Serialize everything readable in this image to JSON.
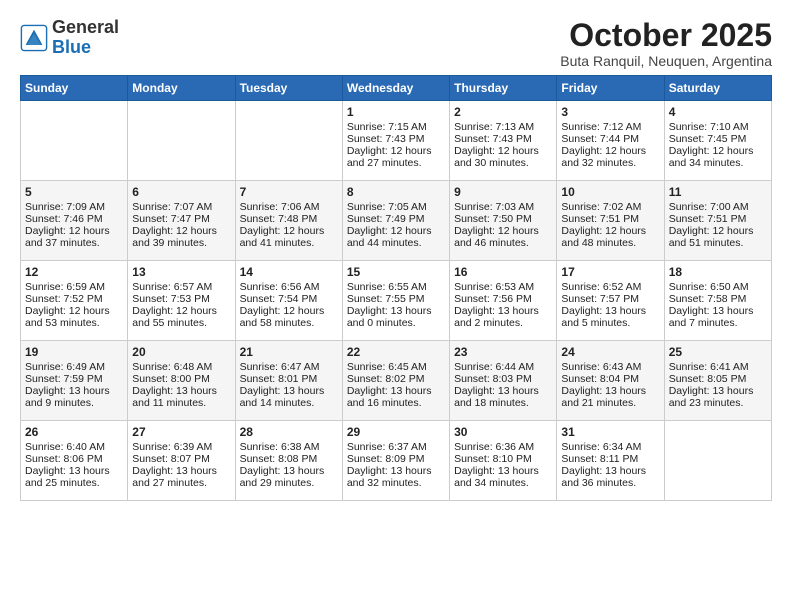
{
  "logo": {
    "general": "General",
    "blue": "Blue"
  },
  "title": "October 2025",
  "subtitle": "Buta Ranquil, Neuquen, Argentina",
  "days_of_week": [
    "Sunday",
    "Monday",
    "Tuesday",
    "Wednesday",
    "Thursday",
    "Friday",
    "Saturday"
  ],
  "weeks": [
    [
      {
        "day": "",
        "info": ""
      },
      {
        "day": "",
        "info": ""
      },
      {
        "day": "",
        "info": ""
      },
      {
        "day": "1",
        "info": "Sunrise: 7:15 AM\nSunset: 7:43 PM\nDaylight: 12 hours\nand 27 minutes."
      },
      {
        "day": "2",
        "info": "Sunrise: 7:13 AM\nSunset: 7:43 PM\nDaylight: 12 hours\nand 30 minutes."
      },
      {
        "day": "3",
        "info": "Sunrise: 7:12 AM\nSunset: 7:44 PM\nDaylight: 12 hours\nand 32 minutes."
      },
      {
        "day": "4",
        "info": "Sunrise: 7:10 AM\nSunset: 7:45 PM\nDaylight: 12 hours\nand 34 minutes."
      }
    ],
    [
      {
        "day": "5",
        "info": "Sunrise: 7:09 AM\nSunset: 7:46 PM\nDaylight: 12 hours\nand 37 minutes."
      },
      {
        "day": "6",
        "info": "Sunrise: 7:07 AM\nSunset: 7:47 PM\nDaylight: 12 hours\nand 39 minutes."
      },
      {
        "day": "7",
        "info": "Sunrise: 7:06 AM\nSunset: 7:48 PM\nDaylight: 12 hours\nand 41 minutes."
      },
      {
        "day": "8",
        "info": "Sunrise: 7:05 AM\nSunset: 7:49 PM\nDaylight: 12 hours\nand 44 minutes."
      },
      {
        "day": "9",
        "info": "Sunrise: 7:03 AM\nSunset: 7:50 PM\nDaylight: 12 hours\nand 46 minutes."
      },
      {
        "day": "10",
        "info": "Sunrise: 7:02 AM\nSunset: 7:51 PM\nDaylight: 12 hours\nand 48 minutes."
      },
      {
        "day": "11",
        "info": "Sunrise: 7:00 AM\nSunset: 7:51 PM\nDaylight: 12 hours\nand 51 minutes."
      }
    ],
    [
      {
        "day": "12",
        "info": "Sunrise: 6:59 AM\nSunset: 7:52 PM\nDaylight: 12 hours\nand 53 minutes."
      },
      {
        "day": "13",
        "info": "Sunrise: 6:57 AM\nSunset: 7:53 PM\nDaylight: 12 hours\nand 55 minutes."
      },
      {
        "day": "14",
        "info": "Sunrise: 6:56 AM\nSunset: 7:54 PM\nDaylight: 12 hours\nand 58 minutes."
      },
      {
        "day": "15",
        "info": "Sunrise: 6:55 AM\nSunset: 7:55 PM\nDaylight: 13 hours\nand 0 minutes."
      },
      {
        "day": "16",
        "info": "Sunrise: 6:53 AM\nSunset: 7:56 PM\nDaylight: 13 hours\nand 2 minutes."
      },
      {
        "day": "17",
        "info": "Sunrise: 6:52 AM\nSunset: 7:57 PM\nDaylight: 13 hours\nand 5 minutes."
      },
      {
        "day": "18",
        "info": "Sunrise: 6:50 AM\nSunset: 7:58 PM\nDaylight: 13 hours\nand 7 minutes."
      }
    ],
    [
      {
        "day": "19",
        "info": "Sunrise: 6:49 AM\nSunset: 7:59 PM\nDaylight: 13 hours\nand 9 minutes."
      },
      {
        "day": "20",
        "info": "Sunrise: 6:48 AM\nSunset: 8:00 PM\nDaylight: 13 hours\nand 11 minutes."
      },
      {
        "day": "21",
        "info": "Sunrise: 6:47 AM\nSunset: 8:01 PM\nDaylight: 13 hours\nand 14 minutes."
      },
      {
        "day": "22",
        "info": "Sunrise: 6:45 AM\nSunset: 8:02 PM\nDaylight: 13 hours\nand 16 minutes."
      },
      {
        "day": "23",
        "info": "Sunrise: 6:44 AM\nSunset: 8:03 PM\nDaylight: 13 hours\nand 18 minutes."
      },
      {
        "day": "24",
        "info": "Sunrise: 6:43 AM\nSunset: 8:04 PM\nDaylight: 13 hours\nand 21 minutes."
      },
      {
        "day": "25",
        "info": "Sunrise: 6:41 AM\nSunset: 8:05 PM\nDaylight: 13 hours\nand 23 minutes."
      }
    ],
    [
      {
        "day": "26",
        "info": "Sunrise: 6:40 AM\nSunset: 8:06 PM\nDaylight: 13 hours\nand 25 minutes."
      },
      {
        "day": "27",
        "info": "Sunrise: 6:39 AM\nSunset: 8:07 PM\nDaylight: 13 hours\nand 27 minutes."
      },
      {
        "day": "28",
        "info": "Sunrise: 6:38 AM\nSunset: 8:08 PM\nDaylight: 13 hours\nand 29 minutes."
      },
      {
        "day": "29",
        "info": "Sunrise: 6:37 AM\nSunset: 8:09 PM\nDaylight: 13 hours\nand 32 minutes."
      },
      {
        "day": "30",
        "info": "Sunrise: 6:36 AM\nSunset: 8:10 PM\nDaylight: 13 hours\nand 34 minutes."
      },
      {
        "day": "31",
        "info": "Sunrise: 6:34 AM\nSunset: 8:11 PM\nDaylight: 13 hours\nand 36 minutes."
      },
      {
        "day": "",
        "info": ""
      }
    ]
  ]
}
